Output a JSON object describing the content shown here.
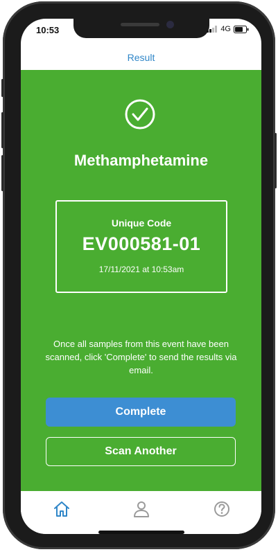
{
  "status_bar": {
    "time": "10:53",
    "network": "4G"
  },
  "nav": {
    "title": "Result"
  },
  "result": {
    "substance": "Methamphetamine",
    "code_label": "Unique Code",
    "code_value": "EV000581-01",
    "timestamp": "17/11/2021 at 10:53am",
    "info_text": "Once all samples from this event have been scanned, click 'Complete' to send the results via email."
  },
  "actions": {
    "complete_label": "Complete",
    "scan_another_label": "Scan Another"
  },
  "tabbar": {
    "items": [
      "home-icon",
      "profile-icon",
      "help-icon"
    ],
    "active": "home-icon"
  },
  "colors": {
    "accent_green": "#4aad31",
    "button_blue": "#3d8ed3",
    "link_blue": "#2f86c8"
  }
}
